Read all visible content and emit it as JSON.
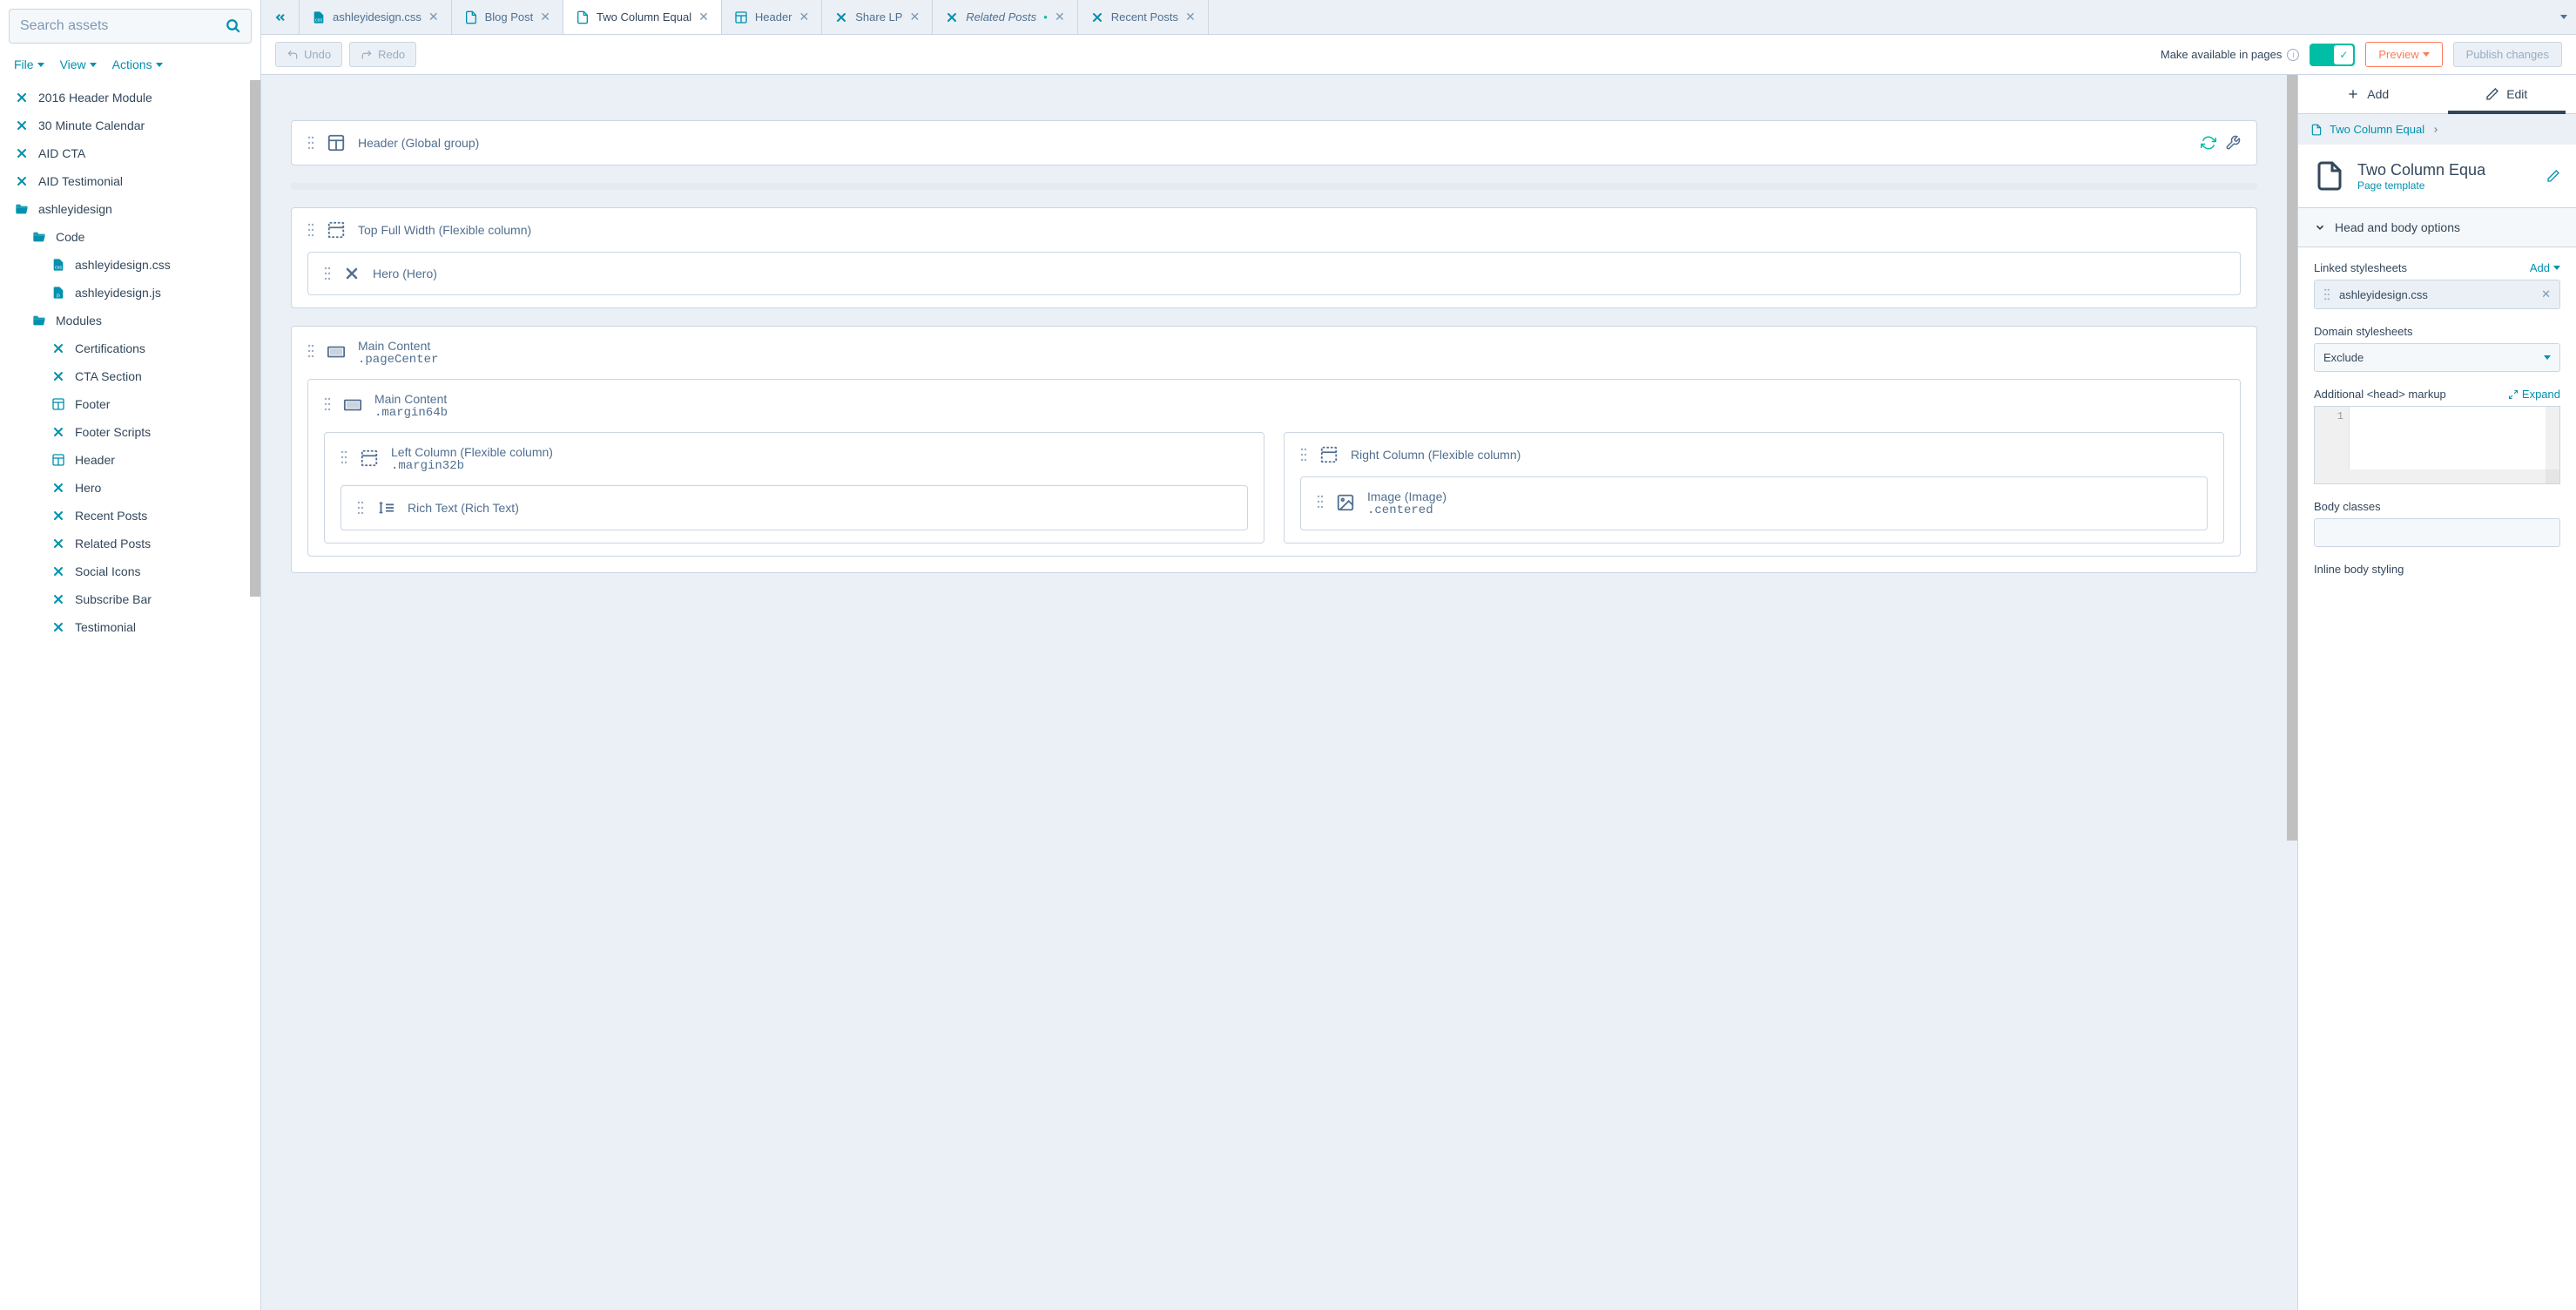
{
  "search": {
    "placeholder": "Search assets"
  },
  "menubar": {
    "file": "File",
    "view": "View",
    "actions": "Actions"
  },
  "tree": [
    {
      "icon": "module",
      "label": "2016 Header Module",
      "indent": 0
    },
    {
      "icon": "module",
      "label": "30 Minute Calendar",
      "indent": 0
    },
    {
      "icon": "module",
      "label": "AID CTA",
      "indent": 0
    },
    {
      "icon": "module",
      "label": "AID Testimonial",
      "indent": 0
    },
    {
      "icon": "folder-open",
      "label": "ashleyidesign",
      "indent": 0
    },
    {
      "icon": "folder-open",
      "label": "Code",
      "indent": 1
    },
    {
      "icon": "css",
      "label": "ashleyidesign.css",
      "indent": 2
    },
    {
      "icon": "js",
      "label": "ashleyidesign.js",
      "indent": 2
    },
    {
      "icon": "folder-open",
      "label": "Modules",
      "indent": 1
    },
    {
      "icon": "module",
      "label": "Certifications",
      "indent": 2
    },
    {
      "icon": "module",
      "label": "CTA Section",
      "indent": 2
    },
    {
      "icon": "layout",
      "label": "Footer",
      "indent": 2
    },
    {
      "icon": "module",
      "label": "Footer Scripts",
      "indent": 2
    },
    {
      "icon": "layout",
      "label": "Header",
      "indent": 2
    },
    {
      "icon": "module",
      "label": "Hero",
      "indent": 2
    },
    {
      "icon": "module",
      "label": "Recent Posts",
      "indent": 2
    },
    {
      "icon": "module",
      "label": "Related Posts",
      "indent": 2
    },
    {
      "icon": "module",
      "label": "Social Icons",
      "indent": 2
    },
    {
      "icon": "module",
      "label": "Subscribe Bar",
      "indent": 2
    },
    {
      "icon": "module",
      "label": "Testimonial",
      "indent": 2
    }
  ],
  "tabs": [
    {
      "icon": "css",
      "label": "ashleyidesign.css",
      "active": false,
      "italic": false,
      "dirty": false
    },
    {
      "icon": "page",
      "label": "Blog Post",
      "active": false,
      "italic": false,
      "dirty": false
    },
    {
      "icon": "page",
      "label": "Two Column Equal",
      "active": true,
      "italic": false,
      "dirty": false
    },
    {
      "icon": "layout",
      "label": "Header",
      "active": false,
      "italic": false,
      "dirty": false
    },
    {
      "icon": "module",
      "label": "Share LP",
      "active": false,
      "italic": false,
      "dirty": false
    },
    {
      "icon": "module",
      "label": "Related Posts",
      "active": false,
      "italic": true,
      "dirty": true
    },
    {
      "icon": "module",
      "label": "Recent Posts",
      "active": false,
      "italic": false,
      "dirty": false
    }
  ],
  "toolbar": {
    "undo": "Undo",
    "redo": "Redo",
    "available": "Make available in pages",
    "preview": "Preview",
    "publish": "Publish changes"
  },
  "canvas": {
    "header_block": "Header (Global group)",
    "top_block": "Top Full Width (Flexible column)",
    "hero_block": "Hero (Hero)",
    "main1_title": "Main Content",
    "main1_class": ".pageCenter",
    "main2_title": "Main Content",
    "main2_class": ".margin64b",
    "left_title": "Left Column (Flexible column)",
    "left_class": ".margin32b",
    "left_inner": "Rich Text (Rich Text)",
    "right_title": "Right Column (Flexible column)",
    "right_inner_title": "Image (Image)",
    "right_inner_class": ".centered"
  },
  "inspector": {
    "tab_add": "Add",
    "tab_edit": "Edit",
    "breadcrumb": "Two Column Equal",
    "title": "Two Column Equa",
    "subtitle": "Page template",
    "section_head": "Head and body options",
    "linked_label": "Linked stylesheets",
    "linked_add": "Add",
    "linked_chip": "ashleyidesign.css",
    "domain_label": "Domain stylesheets",
    "domain_value": "Exclude",
    "headmarkup_label": "Additional <head> markup",
    "expand": "Expand",
    "gutter_line": "1",
    "body_classes_label": "Body classes",
    "inline_label": "Inline body styling"
  }
}
